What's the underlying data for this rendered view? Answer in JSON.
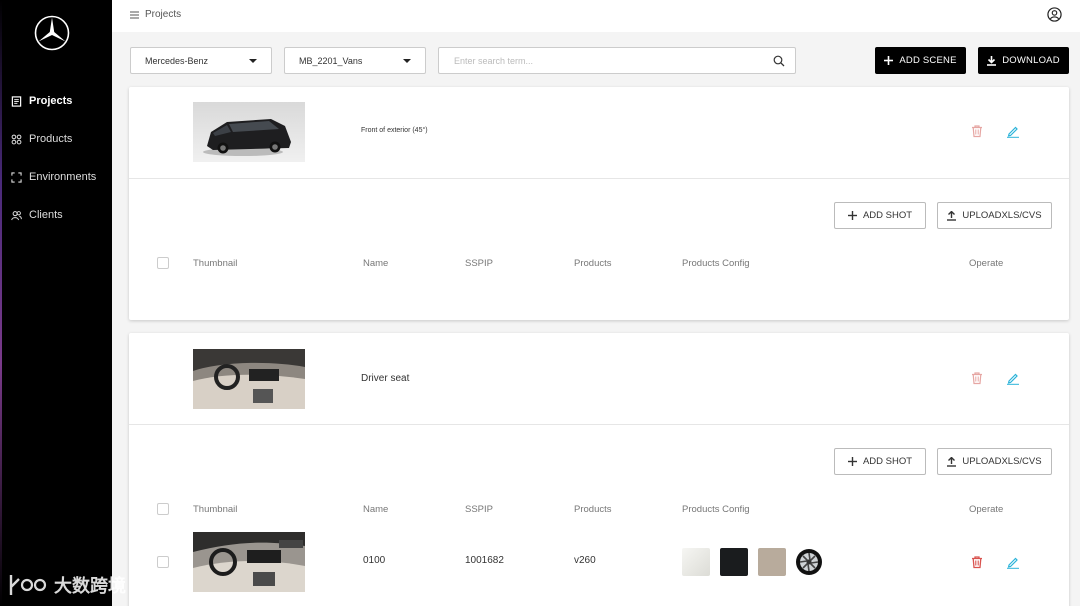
{
  "sidebar": {
    "items": [
      {
        "label": "Projects",
        "icon": "document-icon",
        "active": true
      },
      {
        "label": "Products",
        "icon": "grid-icon",
        "active": false
      },
      {
        "label": "Environments",
        "icon": "expand-icon",
        "active": false
      },
      {
        "label": "Clients",
        "icon": "users-icon",
        "active": false
      }
    ]
  },
  "header": {
    "breadcrumb": "Projects"
  },
  "filters": {
    "brand": "Mercedes-Benz",
    "project": "MB_2201_Vans",
    "search_placeholder": "Enter search term..."
  },
  "toolbar": {
    "add_scene": "ADD SCENE",
    "download": "DOWNLOAD"
  },
  "scenes": [
    {
      "name": "Front of exterior (45°)",
      "add_shot": "ADD SHOT",
      "upload": "UPLOADXLS/CVS",
      "columns": [
        "Thumbnail",
        "Name",
        "SSPIP",
        "Products",
        "Products Config",
        "Operate"
      ],
      "shots": []
    },
    {
      "name": "Driver seat",
      "add_shot": "ADD SHOT",
      "upload": "UPLOADXLS/CVS",
      "columns": [
        "Thumbnail",
        "Name",
        "SSPIP",
        "Products",
        "Products Config",
        "Operate"
      ],
      "shots": [
        {
          "name": "0100",
          "sspip": "1001682",
          "products": "v260",
          "config": [
            "#eaeae6",
            "#1a1c1e",
            "#b8ab9c",
            "wheel"
          ]
        }
      ]
    }
  ],
  "colors": {
    "accent": "#000000",
    "delete": "#d9534f",
    "edit": "#2bb3d9"
  },
  "watermark": "大数跨境"
}
